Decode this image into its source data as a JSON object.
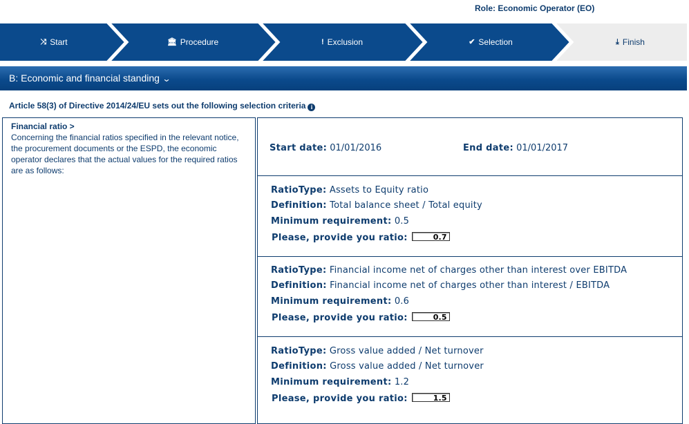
{
  "header": {
    "role": "Role: Economic Operator (EO)"
  },
  "wizard": {
    "steps": [
      {
        "label": "Start",
        "icon": "shuffle-icon",
        "glyph": "⤨"
      },
      {
        "label": "Procedure",
        "icon": "bank-icon",
        "glyph": "🏛"
      },
      {
        "label": "Exclusion",
        "icon": "exclamation-icon",
        "glyph": "!"
      },
      {
        "label": "Selection",
        "icon": "check-circle-icon",
        "glyph": "✔"
      },
      {
        "label": "Finish",
        "icon": "download-icon",
        "glyph": "⤓"
      }
    ],
    "active_color": "#0b4a8c",
    "inactive_color": "#ededed"
  },
  "section": {
    "title": "B: Economic and financial standing",
    "chevron": "❯"
  },
  "article": {
    "text": "Article 58(3) of Directive 2014/24/EU sets out the following selection criteria",
    "info": "i"
  },
  "criterion": {
    "title": "Financial ratio >",
    "description": "Concerning the financial ratios specified in the relevant notice, the procurement documents or the ESPD, the economic operator declares that the actual values for the required ratios are as follows:"
  },
  "dates": {
    "start_label": "Start date:",
    "start_value": "01/01/2016",
    "end_label": "End date:",
    "end_value": "01/01/2017"
  },
  "labels": {
    "type": "RatioType:",
    "definition": "Definition:",
    "minimum": "Minimum requirement:",
    "provide": "Please, provide you ratio:"
  },
  "ratios": [
    {
      "type": "Assets to Equity ratio",
      "definition": "Total balance sheet / Total equity",
      "minimum": "0.5",
      "value": "0.7"
    },
    {
      "type": "Financial income net of charges other than interest over EBITDA",
      "definition": "Financial income net of charges other than interest / EBITDA",
      "minimum": "0.6",
      "value": "0.5"
    },
    {
      "type": "Gross value added / Net turnover",
      "definition": "Gross value added / Net turnover",
      "minimum": "1.2",
      "value": "1.5"
    }
  ]
}
